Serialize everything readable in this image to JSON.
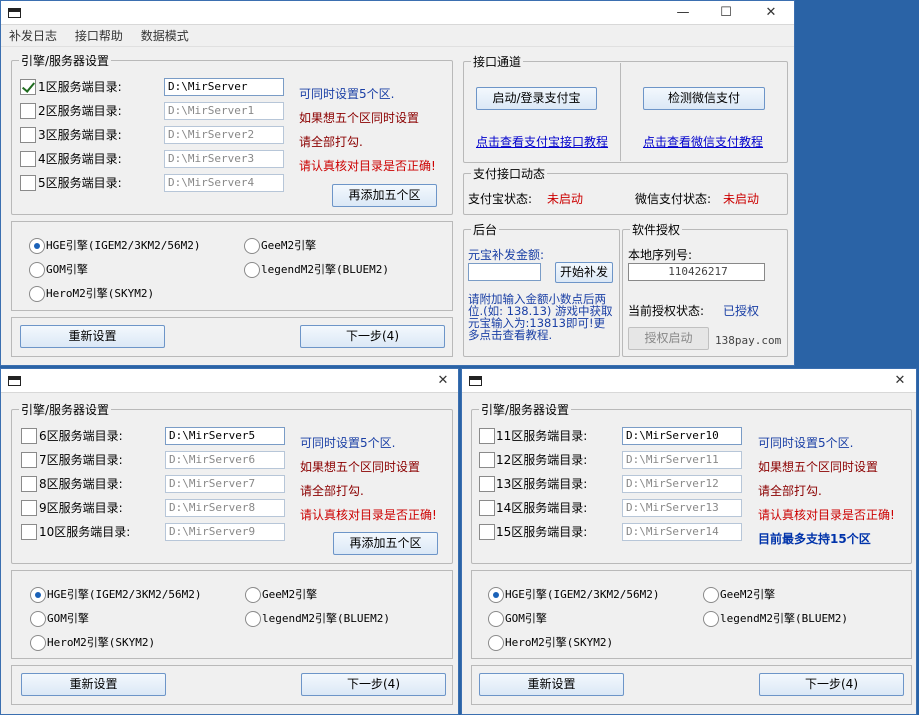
{
  "main_window": {
    "menu": [
      "补发日志",
      "接口帮助",
      "数据模式"
    ],
    "controls": {
      "minimize": "—",
      "maximize": "☐",
      "close": "✕"
    },
    "server_group": {
      "legend": "引擎/服务器设置",
      "rows": [
        {
          "label": "1区服务端目录:",
          "value": "D:\\MirServer",
          "checked": true
        },
        {
          "label": "2区服务端目录:",
          "value": "D:\\MirServer1",
          "checked": false
        },
        {
          "label": "3区服务端目录:",
          "value": "D:\\MirServer2",
          "checked": false
        },
        {
          "label": "4区服务端目录:",
          "value": "D:\\MirServer3",
          "checked": false
        },
        {
          "label": "5区服务端目录:",
          "value": "D:\\MirServer4",
          "checked": false
        }
      ],
      "notes": [
        "可同时设置5个区.",
        "如果想五个区同时设置",
        "请全部打勾.",
        "请认真核对目录是否正确!"
      ],
      "add_button": "再添加五个区"
    },
    "engines": [
      "HGE引擎(IGEM2/3KM2/56M2)",
      "GeeM2引擎",
      "GOM引擎",
      "legendM2引擎(BLUEM2)",
      "HeroM2引擎(SKYM2)"
    ],
    "reset_button": "重新设置",
    "next_button": "下一步(4)",
    "interface": {
      "legend": "接口通道",
      "alipay_button": "启动/登录支付宝",
      "wechat_button": "检测微信支付",
      "alipay_link": "点击查看支付宝接口教程",
      "wechat_link": "点击查看微信支付教程"
    },
    "status": {
      "legend": "支付接口动态",
      "alipay_label": "支付宝状态:",
      "alipay_value": "未启动",
      "wechat_label": "微信支付状态:",
      "wechat_value": "未启动"
    },
    "backend": {
      "legend": "后台",
      "amount_label": "元宝补发金额:",
      "start_button": "开始补发",
      "help": "请附加输入金额小数点后两位.(如: 138.13) 游戏中获取元宝输入为:13813即可!更多点击查看教程."
    },
    "license": {
      "legend": "软件授权",
      "serial_label": "本地序列号:",
      "serial_value": "110426217",
      "state_label": "当前授权状态:",
      "state_value": "已授权",
      "auth_button": "授权启动",
      "site": "138pay.com"
    }
  },
  "window2": {
    "close": "✕",
    "legend": "引擎/服务器设置",
    "rows": [
      {
        "label": "6区服务端目录:",
        "value": "D:\\MirServer5"
      },
      {
        "label": "7区服务端目录:",
        "value": "D:\\MirServer6"
      },
      {
        "label": "8区服务端目录:",
        "value": "D:\\MirServer7"
      },
      {
        "label": "9区服务端目录:",
        "value": "D:\\MirServer8"
      },
      {
        "label": "10区服务端目录:",
        "value": "D:\\MirServer9"
      }
    ],
    "notes": [
      "可同时设置5个区.",
      "如果想五个区同时设置",
      "请全部打勾.",
      "请认真核对目录是否正确!"
    ],
    "add_button": "再添加五个区",
    "engines": [
      "HGE引擎(IGEM2/3KM2/56M2)",
      "GeeM2引擎",
      "GOM引擎",
      "legendM2引擎(BLUEM2)",
      "HeroM2引擎(SKYM2)"
    ],
    "reset_button": "重新设置",
    "next_button": "下一步(4)"
  },
  "window3": {
    "close": "✕",
    "legend": "引擎/服务器设置",
    "rows": [
      {
        "label": "11区服务端目录:",
        "value": "D:\\MirServer10"
      },
      {
        "label": "12区服务端目录:",
        "value": "D:\\MirServer11"
      },
      {
        "label": "13区服务端目录:",
        "value": "D:\\MirServer12"
      },
      {
        "label": "14区服务端目录:",
        "value": "D:\\MirServer13"
      },
      {
        "label": "15区服务端目录:",
        "value": "D:\\MirServer14"
      }
    ],
    "notes": [
      "可同时设置5个区.",
      "如果想五个区同时设置",
      "请全部打勾.",
      "请认真核对目录是否正确!",
      "目前最多支持15个区"
    ],
    "engines": [
      "HGE引擎(IGEM2/3KM2/56M2)",
      "GeeM2引擎",
      "GOM引擎",
      "legendM2引擎(BLUEM2)",
      "HeroM2引擎(SKYM2)"
    ],
    "reset_button": "重新设置",
    "next_button": "下一步(4)"
  }
}
